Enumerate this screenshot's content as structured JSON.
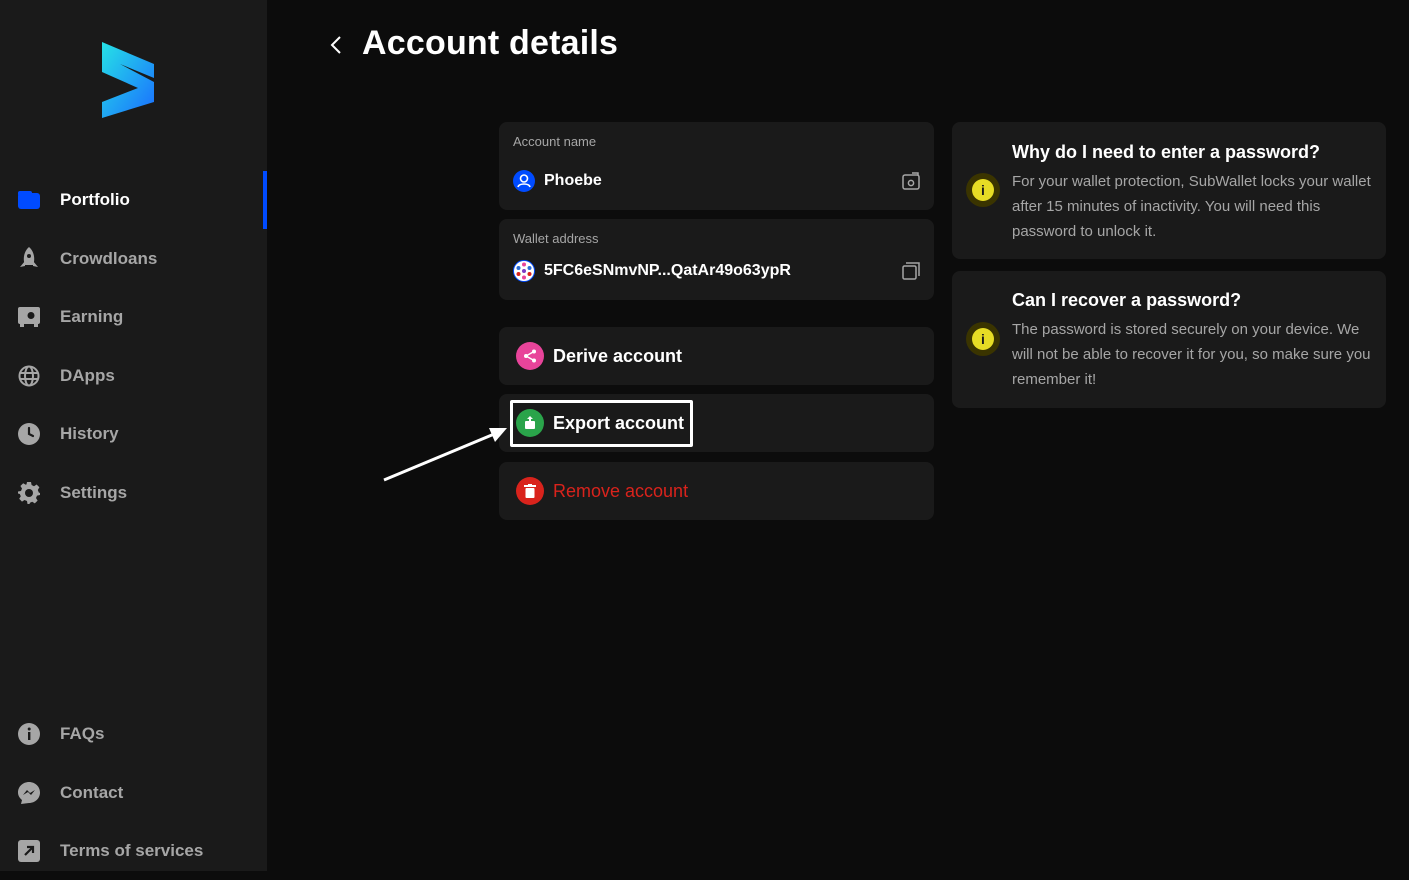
{
  "sidebar": {
    "items": [
      {
        "label": "Portfolio",
        "icon": "wallet-icon",
        "active": true
      },
      {
        "label": "Crowdloans",
        "icon": "rocket-icon"
      },
      {
        "label": "Earning",
        "icon": "vault-icon"
      },
      {
        "label": "DApps",
        "icon": "globe-icon"
      },
      {
        "label": "History",
        "icon": "clock-icon"
      },
      {
        "label": "Settings",
        "icon": "gear-icon"
      }
    ],
    "footer": [
      {
        "label": "FAQs",
        "icon": "info-icon"
      },
      {
        "label": "Contact",
        "icon": "messenger-icon"
      },
      {
        "label": "Terms of services",
        "icon": "external-link-icon"
      }
    ]
  },
  "header": {
    "title": "Account details"
  },
  "account": {
    "name_label": "Account name",
    "name_value": "Phoebe",
    "address_label": "Wallet address",
    "address_value": "5FC6eSNmvNP...QatAr49o63ypR"
  },
  "actions": {
    "derive": "Derive account",
    "export": "Export account",
    "remove": "Remove account"
  },
  "info": [
    {
      "title": "Why do I need to enter a password?",
      "body": "For your wallet protection, SubWallet locks your wallet after 15 minutes of inactivity. You will need this password to unlock it."
    },
    {
      "title": "Can I recover a password?",
      "body": "The password is stored securely on your device. We will not be able to recover it for you, so make sure you remember it!"
    }
  ],
  "colors": {
    "accent": "#004bff",
    "derive": "#e8449a",
    "export": "#2aa44a",
    "remove": "#d9231c",
    "warning": "#e6dc25"
  }
}
